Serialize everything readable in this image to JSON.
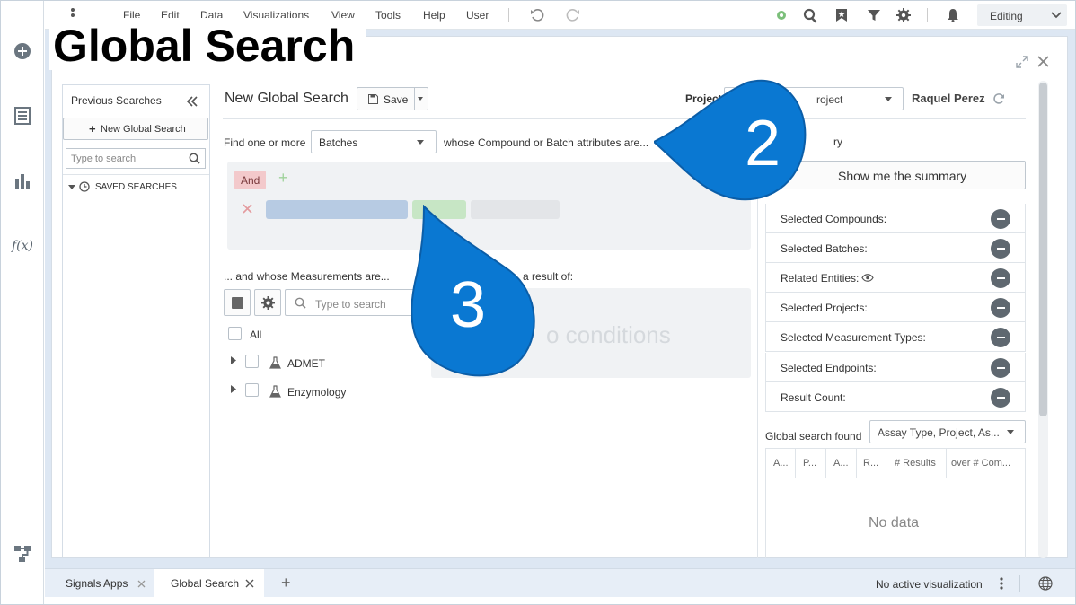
{
  "menu": {
    "items": [
      "File",
      "Edit",
      "Data",
      "Visualizations",
      "View",
      "Tools",
      "Help",
      "User"
    ],
    "mode": "Editing"
  },
  "overlay_title": "Global Search",
  "previous_searches": {
    "title": "Previous Searches",
    "new_button": "New Global Search",
    "search_placeholder": "Type to search",
    "saved_label": "SAVED SEARCHES"
  },
  "search": {
    "title": "New Global Search",
    "save_label": "Save",
    "project_label": "Project:",
    "project_value": "roject",
    "user": "Raquel Perez",
    "find_label": "Find one or more",
    "entity_value": "Batches",
    "attributes_label": "whose Compound or Batch attributes are...",
    "and_label": "And",
    "measurements_label": "... and whose Measurements are...",
    "result_of_label": "a result of:",
    "measure_search_placeholder": "Type to search",
    "tree": {
      "all_label": "All",
      "items": [
        "ADMET",
        "Enzymology"
      ]
    },
    "no_conditions": "o conditions"
  },
  "summary": {
    "heading": "ry",
    "show_button": "Show me the summary",
    "rows": [
      "Selected Compounds:",
      "Selected Batches:",
      "Related Entities:",
      "Selected Projects:",
      "Selected Measurement Types:",
      "Selected Endpoints:",
      "Result Count:"
    ],
    "found_label": "Global search found",
    "found_select": "Assay Type, Project, As...",
    "columns": [
      "A...",
      "P...",
      "A...",
      "R...",
      "# Results",
      "over # Com..."
    ],
    "empty": "No data"
  },
  "tabs": {
    "items": [
      "Signals Apps",
      "Global Search"
    ],
    "status": "No active visualization"
  },
  "callouts": [
    "2",
    "3"
  ],
  "colors": {
    "callout_blue": "#0a78d2",
    "workspace_bg": "#dde7f3",
    "and_chip": "#f3c9cb",
    "chip_blue": "#b7cbe3",
    "chip_green": "#c7e6c5"
  }
}
